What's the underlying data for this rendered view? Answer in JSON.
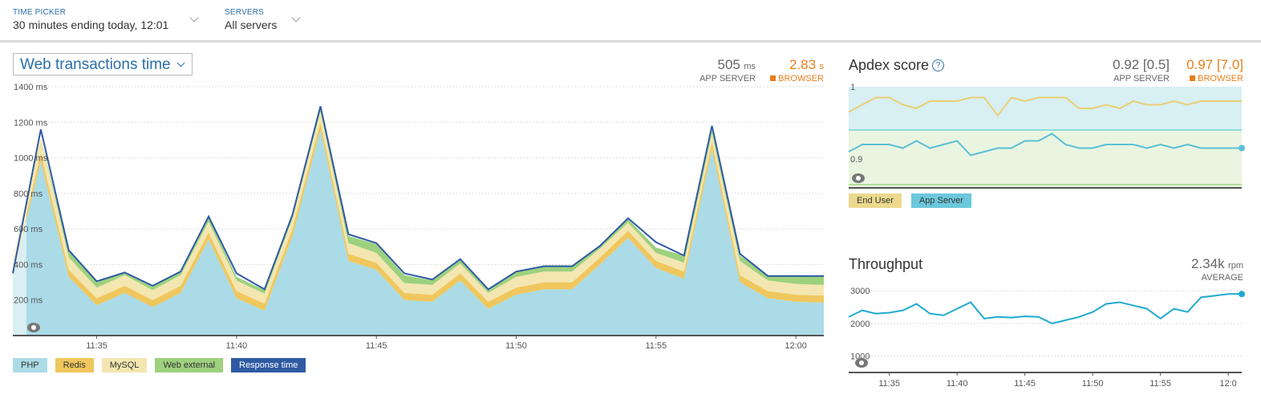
{
  "time_picker": {
    "label": "TIME PICKER",
    "value": "30 minutes ending today, 12:01"
  },
  "servers": {
    "label": "SERVERS",
    "value": "All servers"
  },
  "web": {
    "dropdown": "Web transactions time",
    "app_server": {
      "value": "505",
      "unit": "ms",
      "label": "APP SERVER"
    },
    "browser": {
      "value": "2.83",
      "unit": "s",
      "label": "BROWSER"
    },
    "legend": [
      "PHP",
      "Redis",
      "MySQL",
      "Web external",
      "Response time"
    ]
  },
  "apdex": {
    "title": "Apdex score",
    "app_server": {
      "value": "0.92 [0.5]",
      "label": "APP SERVER"
    },
    "browser": {
      "value": "0.97 [7.0]",
      "label": "BROWSER"
    },
    "legend": [
      "End User",
      "App Server"
    ]
  },
  "throughput": {
    "title": "Throughput",
    "value": "2.34k",
    "unit": "rpm",
    "label": "AVERAGE"
  },
  "colors": {
    "php": "#aadbe6",
    "redis": "#f0c75e",
    "mysql": "#f3e6b0",
    "external": "#9dd17e",
    "response": "#2f5aa3",
    "endUser": "#e8cf74",
    "appServer": "#5bbfd6",
    "throughput": "#1eaad0",
    "browser": "#e87e1c"
  },
  "chart_data": [
    {
      "type": "area",
      "title": "Web transactions time",
      "ylabel": "ms",
      "ylim": [
        0,
        1400
      ],
      "yticks": [
        "1400 ms",
        "1200 ms",
        "1000 ms",
        "800 ms",
        "600 ms",
        "400 ms",
        "200 ms"
      ],
      "xticks": [
        "11:35",
        "11:40",
        "11:45",
        "11:50",
        "11:55",
        "12:00"
      ],
      "x": [
        "11:32",
        "11:33",
        "11:34",
        "11:35",
        "11:36",
        "11:37",
        "11:38",
        "11:39",
        "11:40",
        "11:41",
        "11:42",
        "11:43",
        "11:44",
        "11:45",
        "11:46",
        "11:47",
        "11:48",
        "11:49",
        "11:50",
        "11:51",
        "11:52",
        "11:53",
        "11:54",
        "11:55",
        "11:56",
        "11:57",
        "11:58",
        "11:59",
        "12:00",
        "12:01"
      ],
      "series": [
        {
          "name": "PHP",
          "values": [
            340,
            980,
            330,
            170,
            240,
            160,
            240,
            540,
            210,
            140,
            560,
            1160,
            420,
            370,
            200,
            190,
            310,
            150,
            230,
            260,
            260,
            400,
            550,
            380,
            320,
            1050,
            300,
            210,
            190,
            185
          ]
        },
        {
          "name": "Redis",
          "values": [
            20,
            45,
            40,
            40,
            40,
            40,
            40,
            40,
            40,
            40,
            40,
            40,
            40,
            40,
            40,
            40,
            40,
            40,
            40,
            40,
            40,
            40,
            40,
            40,
            40,
            40,
            40,
            40,
            40,
            40
          ]
        },
        {
          "name": "MySQL",
          "values": [
            80,
            90,
            70,
            60,
            60,
            55,
            60,
            60,
            60,
            55,
            60,
            60,
            60,
            55,
            55,
            55,
            55,
            50,
            60,
            60,
            60,
            50,
            45,
            45,
            50,
            45,
            80,
            60,
            60,
            60
          ]
        },
        {
          "name": "Web external",
          "values": [
            0,
            0,
            35,
            30,
            20,
            20,
            20,
            25,
            20,
            20,
            20,
            25,
            40,
            50,
            45,
            25,
            20,
            15,
            30,
            35,
            35,
            20,
            20,
            30,
            40,
            20,
            30,
            30,
            50,
            50
          ]
        },
        {
          "name": "Response time",
          "values": [
            350,
            1160,
            480,
            305,
            355,
            280,
            360,
            670,
            350,
            260,
            680,
            1290,
            570,
            520,
            350,
            315,
            430,
            260,
            360,
            390,
            390,
            505,
            660,
            525,
            450,
            1180,
            460,
            335,
            335,
            335
          ]
        }
      ]
    },
    {
      "type": "line",
      "title": "Apdex score",
      "ylim": [
        0.86,
        1.0
      ],
      "yticks": [
        "1",
        "0.9"
      ],
      "x": [
        "11:32",
        "11:33",
        "11:34",
        "11:35",
        "11:36",
        "11:37",
        "11:38",
        "11:39",
        "11:40",
        "11:41",
        "11:42",
        "11:43",
        "11:44",
        "11:45",
        "11:46",
        "11:47",
        "11:48",
        "11:49",
        "11:50",
        "11:51",
        "11:52",
        "11:53",
        "11:54",
        "11:55",
        "11:56",
        "11:57",
        "11:58",
        "11:59",
        "12:00",
        "12:01"
      ],
      "series": [
        {
          "name": "End User",
          "values": [
            0.965,
            0.975,
            0.985,
            0.985,
            0.975,
            0.97,
            0.98,
            0.98,
            0.98,
            0.985,
            0.985,
            0.96,
            0.985,
            0.98,
            0.985,
            0.985,
            0.985,
            0.97,
            0.97,
            0.975,
            0.97,
            0.98,
            0.975,
            0.975,
            0.98,
            0.975,
            0.98,
            0.98,
            0.98,
            0.98
          ]
        },
        {
          "name": "App Server",
          "values": [
            0.91,
            0.92,
            0.92,
            0.92,
            0.915,
            0.925,
            0.915,
            0.92,
            0.925,
            0.905,
            0.91,
            0.915,
            0.915,
            0.925,
            0.925,
            0.935,
            0.92,
            0.915,
            0.915,
            0.92,
            0.92,
            0.92,
            0.915,
            0.92,
            0.915,
            0.92,
            0.915,
            0.915,
            0.915,
            0.915
          ]
        }
      ]
    },
    {
      "type": "line",
      "title": "Throughput",
      "ylabel": "rpm",
      "ylim": [
        500,
        3300
      ],
      "yticks": [
        "3000",
        "2000",
        "1000"
      ],
      "xticks": [
        "11:35",
        "11:40",
        "11:45",
        "11:50",
        "11:55",
        "12:0"
      ],
      "x": [
        "11:32",
        "11:33",
        "11:34",
        "11:35",
        "11:36",
        "11:37",
        "11:38",
        "11:39",
        "11:40",
        "11:41",
        "11:42",
        "11:43",
        "11:44",
        "11:45",
        "11:46",
        "11:47",
        "11:48",
        "11:49",
        "11:50",
        "11:51",
        "11:52",
        "11:53",
        "11:54",
        "11:55",
        "11:56",
        "11:57",
        "11:58",
        "11:59",
        "12:00",
        "12:01"
      ],
      "series": [
        {
          "name": "Throughput",
          "values": [
            2200,
            2400,
            2300,
            2330,
            2400,
            2600,
            2300,
            2250,
            2450,
            2650,
            2150,
            2200,
            2180,
            2220,
            2200,
            2000,
            2100,
            2200,
            2350,
            2600,
            2650,
            2550,
            2450,
            2150,
            2450,
            2350,
            2800,
            2850,
            2900,
            2900
          ]
        }
      ]
    }
  ]
}
